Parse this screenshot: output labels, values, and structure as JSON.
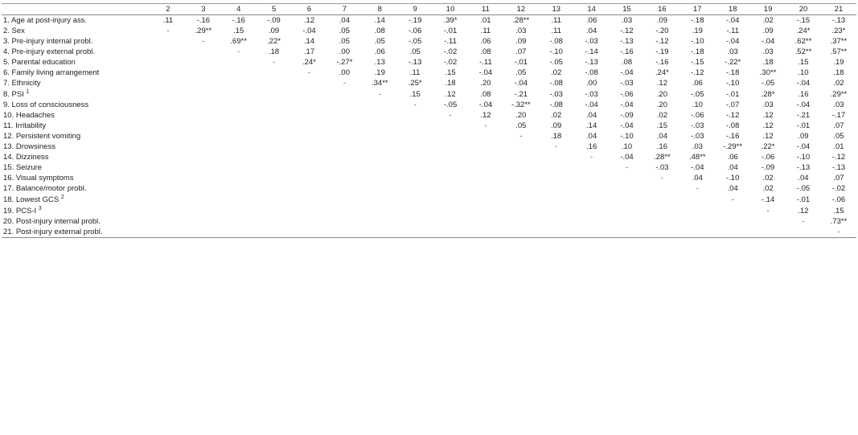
{
  "table": {
    "columns": [
      "",
      "2",
      "3",
      "4",
      "5",
      "6",
      "7",
      "8",
      "9",
      "10",
      "11",
      "12",
      "13",
      "14",
      "15",
      "16",
      "17",
      "18",
      "19",
      "20",
      "21"
    ],
    "rows": [
      {
        "label": "1. Age at post-injury ass.",
        "values": [
          ".11",
          "-.16",
          "-.16",
          "-.09",
          ".12",
          ".04",
          ".14",
          "-.19",
          ".39*",
          ".01",
          ".28**",
          ".11",
          ".06",
          ".03",
          ".09",
          "-.18",
          "-.04",
          ".02",
          "-.15",
          "-.13"
        ]
      },
      {
        "label": "2. Sex",
        "values": [
          "-",
          ".29**",
          ".15",
          ".09",
          "-.04",
          ".05",
          ".08",
          "-.06",
          "-.01",
          ".11",
          ".03",
          ".11",
          ".04",
          "-.12",
          "-.20",
          ".19",
          "-.11",
          ".09",
          ".24*",
          ".23*"
        ]
      },
      {
        "label": "3. Pre-injury internal probl.",
        "values": [
          "",
          "-",
          ".69**",
          ".22*",
          ".14",
          ".05",
          ".05",
          "-.05",
          "-.11",
          ".06",
          ".09",
          "-.08",
          "-.03",
          "-.13",
          "-.12",
          "-.10",
          "-.04",
          "-.04",
          ".62**",
          ".37**"
        ]
      },
      {
        "label": "4. Pre-injury external probl.",
        "values": [
          "",
          "",
          "-",
          ".18",
          ".17",
          ".00",
          ".06",
          ".05",
          "-.02",
          ".08",
          ".07",
          "-.10",
          "-.14",
          "-.16",
          "-.19",
          "-.18",
          ".03",
          ".03",
          ".52**",
          ".57**"
        ]
      },
      {
        "label": "5. Parental education",
        "values": [
          "",
          "",
          "",
          "-",
          ".24*",
          "-.27*",
          ".13",
          "-.13",
          "-.02",
          "-.11",
          "-.01",
          "-.05",
          "-.13",
          ".08",
          "-.16",
          "-.15",
          "-.22*",
          ".18",
          ".15",
          ".19"
        ]
      },
      {
        "label": "6. Family living arrangement",
        "values": [
          "",
          "",
          "",
          "",
          "-",
          ".00",
          ".19",
          ".11",
          ".15",
          "-.04",
          ".05",
          ".02",
          "-.08",
          "-.04",
          ".24*",
          "-.12",
          "-.18",
          ".30**",
          ".10",
          ".18"
        ]
      },
      {
        "label": "7. Ethnicity",
        "values": [
          "",
          "",
          "",
          "",
          "",
          "-",
          ".34**",
          ".25*",
          ".18",
          ".20",
          "-.04",
          "-.08",
          ".00",
          "-.03",
          ".12",
          ".06",
          "-.10",
          "-.05",
          "-.04",
          ".02"
        ]
      },
      {
        "label": "8. PSI ¹",
        "values": [
          "",
          "",
          "",
          "",
          "",
          "",
          "-",
          ".15",
          ".12",
          ".08",
          "-.21",
          "-.03",
          "-.03",
          "-.06",
          ".20",
          "-.05",
          "-.01",
          ".28*",
          ".16",
          ".29**"
        ],
        "superscript": "1"
      },
      {
        "label": "9. Loss of consciousness",
        "values": [
          "",
          "",
          "",
          "",
          "",
          "",
          "",
          "-",
          "-.05",
          "-.04",
          "-.32**",
          "-.08",
          "-.04",
          "-.04",
          ".20",
          ".10",
          "-.07",
          ".03",
          "-.04",
          ".03"
        ]
      },
      {
        "label": "10. Headaches",
        "values": [
          "",
          "",
          "",
          "",
          "",
          "",
          "",
          "",
          "-",
          ".12",
          ".20",
          ".02",
          ".04",
          "-.09",
          ".02",
          "-.06",
          "-.12",
          ".12",
          "-.21",
          "-.17"
        ]
      },
      {
        "label": "11. Irritability",
        "values": [
          "",
          "",
          "",
          "",
          "",
          "",
          "",
          "",
          "",
          "-",
          ".05",
          ".09",
          ".14",
          "-.04",
          ".15",
          "-.03",
          "-.08",
          ".12",
          "-.01",
          ".07"
        ]
      },
      {
        "label": "12. Persistent vomiting",
        "values": [
          "",
          "",
          "",
          "",
          "",
          "",
          "",
          "",
          "",
          "",
          "-",
          ".18",
          ".04",
          "-.10",
          ".04",
          "-.03",
          "-.16",
          ".12",
          ".09",
          ".05"
        ]
      },
      {
        "label": "13. Drowsiness",
        "values": [
          "",
          "",
          "",
          "",
          "",
          "",
          "",
          "",
          "",
          "",
          "",
          "-",
          ".16",
          ".10",
          ".16",
          ".03",
          "-.29**",
          ".22*",
          "-.04",
          ".01"
        ]
      },
      {
        "label": "14. Dizziness",
        "values": [
          "",
          "",
          "",
          "",
          "",
          "",
          "",
          "",
          "",
          "",
          "",
          "",
          "-",
          "-.04",
          ".28**",
          ".48**",
          ".06",
          "-.06",
          "-.10",
          "-.12"
        ]
      },
      {
        "label": "15. Seizure",
        "values": [
          "",
          "",
          "",
          "",
          "",
          "",
          "",
          "",
          "",
          "",
          "",
          "",
          "",
          "-",
          "-.03",
          "-.04",
          ".04",
          "-.09",
          "-.13",
          "-.13"
        ]
      },
      {
        "label": "16. Visual symptoms",
        "values": [
          "",
          "",
          "",
          "",
          "",
          "",
          "",
          "",
          "",
          "",
          "",
          "",
          "",
          "",
          "-",
          ".04",
          "-.10",
          ".02",
          ".04",
          ".07"
        ]
      },
      {
        "label": "17. Balance/motor probl.",
        "values": [
          "",
          "",
          "",
          "",
          "",
          "",
          "",
          "",
          "",
          "",
          "",
          "",
          "",
          "",
          "",
          "-",
          ".04",
          ".02",
          "-.05",
          "-.02"
        ]
      },
      {
        "label": "18. Lowest GCS ²",
        "values": [
          "",
          "",
          "",
          "",
          "",
          "",
          "",
          "",
          "",
          "",
          "",
          "",
          "",
          "",
          "",
          "",
          "-",
          "-.14",
          "-.01",
          "-.06"
        ],
        "superscript": "2"
      },
      {
        "label": "19. PCS-I ³",
        "values": [
          "",
          "",
          "",
          "",
          "",
          "",
          "",
          "",
          "",
          "",
          "",
          "",
          "",
          "",
          "",
          "",
          "",
          "-",
          ".12",
          ".15"
        ],
        "superscript": "3"
      },
      {
        "label": "20. Post-injury internal probl.",
        "values": [
          "",
          "",
          "",
          "",
          "",
          "",
          "",
          "",
          "",
          "",
          "",
          "",
          "",
          "",
          "",
          "",
          "",
          "",
          "-",
          ".73**"
        ]
      },
      {
        "label": "21. Post-injury external probl.",
        "values": [
          "",
          "",
          "",
          "",
          "",
          "",
          "",
          "",
          "",
          "",
          "",
          "",
          "",
          "",
          "",
          "",
          "",
          "",
          "",
          "-"
        ]
      }
    ]
  }
}
